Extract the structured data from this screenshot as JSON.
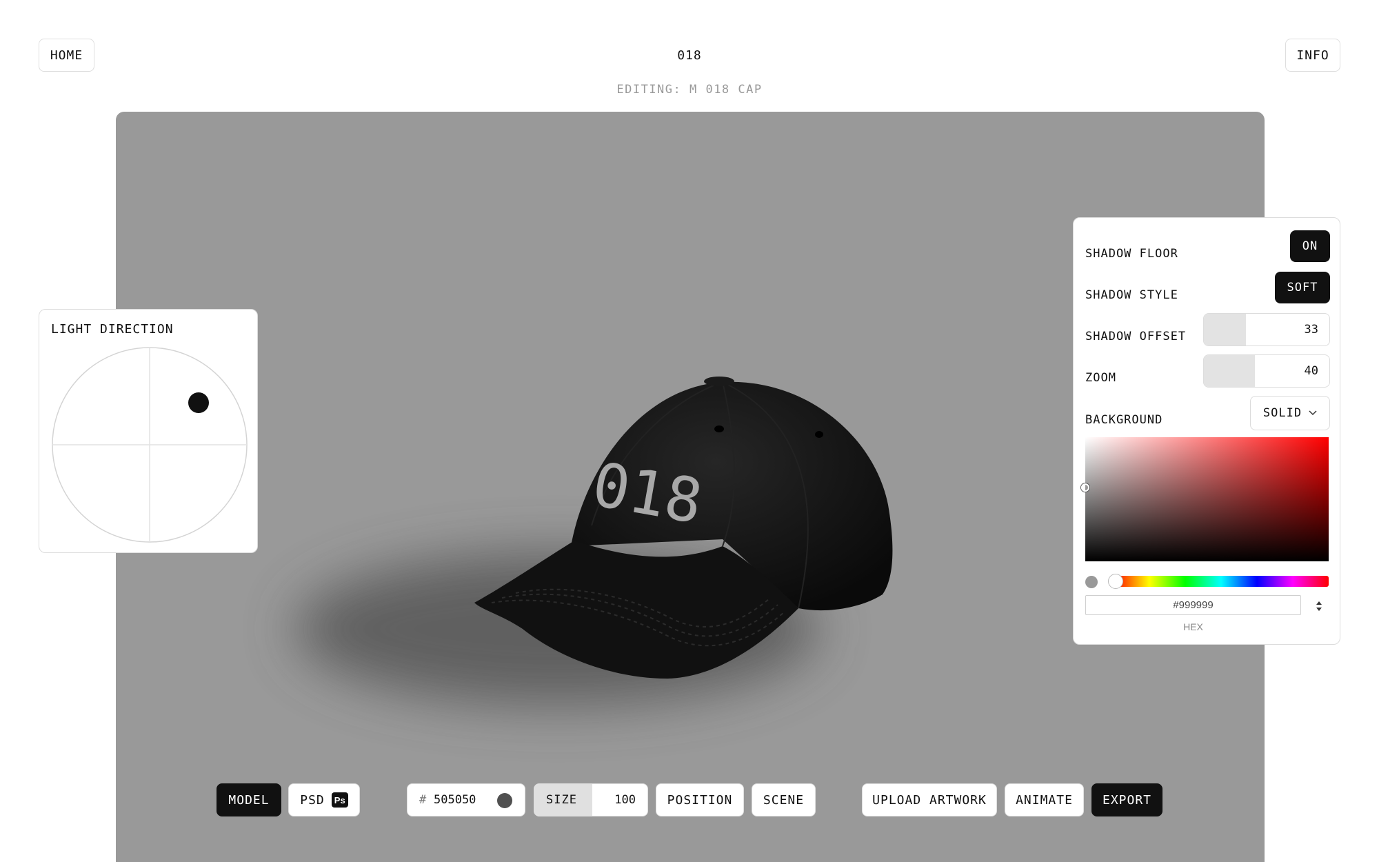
{
  "header": {
    "home_label": "HOME",
    "title": "018",
    "info_label": "INFO",
    "editing_label": "EDITING: M 018 CAP"
  },
  "viewport": {
    "background_color": "#999999",
    "cap_text": "018"
  },
  "light_direction": {
    "title": "LIGHT DIRECTION"
  },
  "settings": {
    "shadow_floor": {
      "label": "SHADOW FLOOR",
      "value": "ON"
    },
    "shadow_style": {
      "label": "SHADOW STYLE",
      "value": "SOFT"
    },
    "shadow_offset": {
      "label": "SHADOW OFFSET",
      "value": "33"
    },
    "zoom": {
      "label": "ZOOM",
      "value": "40"
    },
    "background": {
      "label": "BACKGROUND",
      "value": "SOLID"
    },
    "color_picker": {
      "hex_value": "#999999",
      "hex_label": "HEX"
    }
  },
  "toolbar": {
    "model_label": "MODEL",
    "psd_label": "PSD",
    "ps_badge": "Ps",
    "color_hash": "#",
    "color_value": "505050",
    "color_swatch": "#505050",
    "size_label": "SIZE",
    "size_value": "100",
    "position_label": "POSITION",
    "scene_label": "SCENE",
    "upload_label": "UPLOAD ARTWORK",
    "animate_label": "ANIMATE",
    "export_label": "EXPORT"
  }
}
